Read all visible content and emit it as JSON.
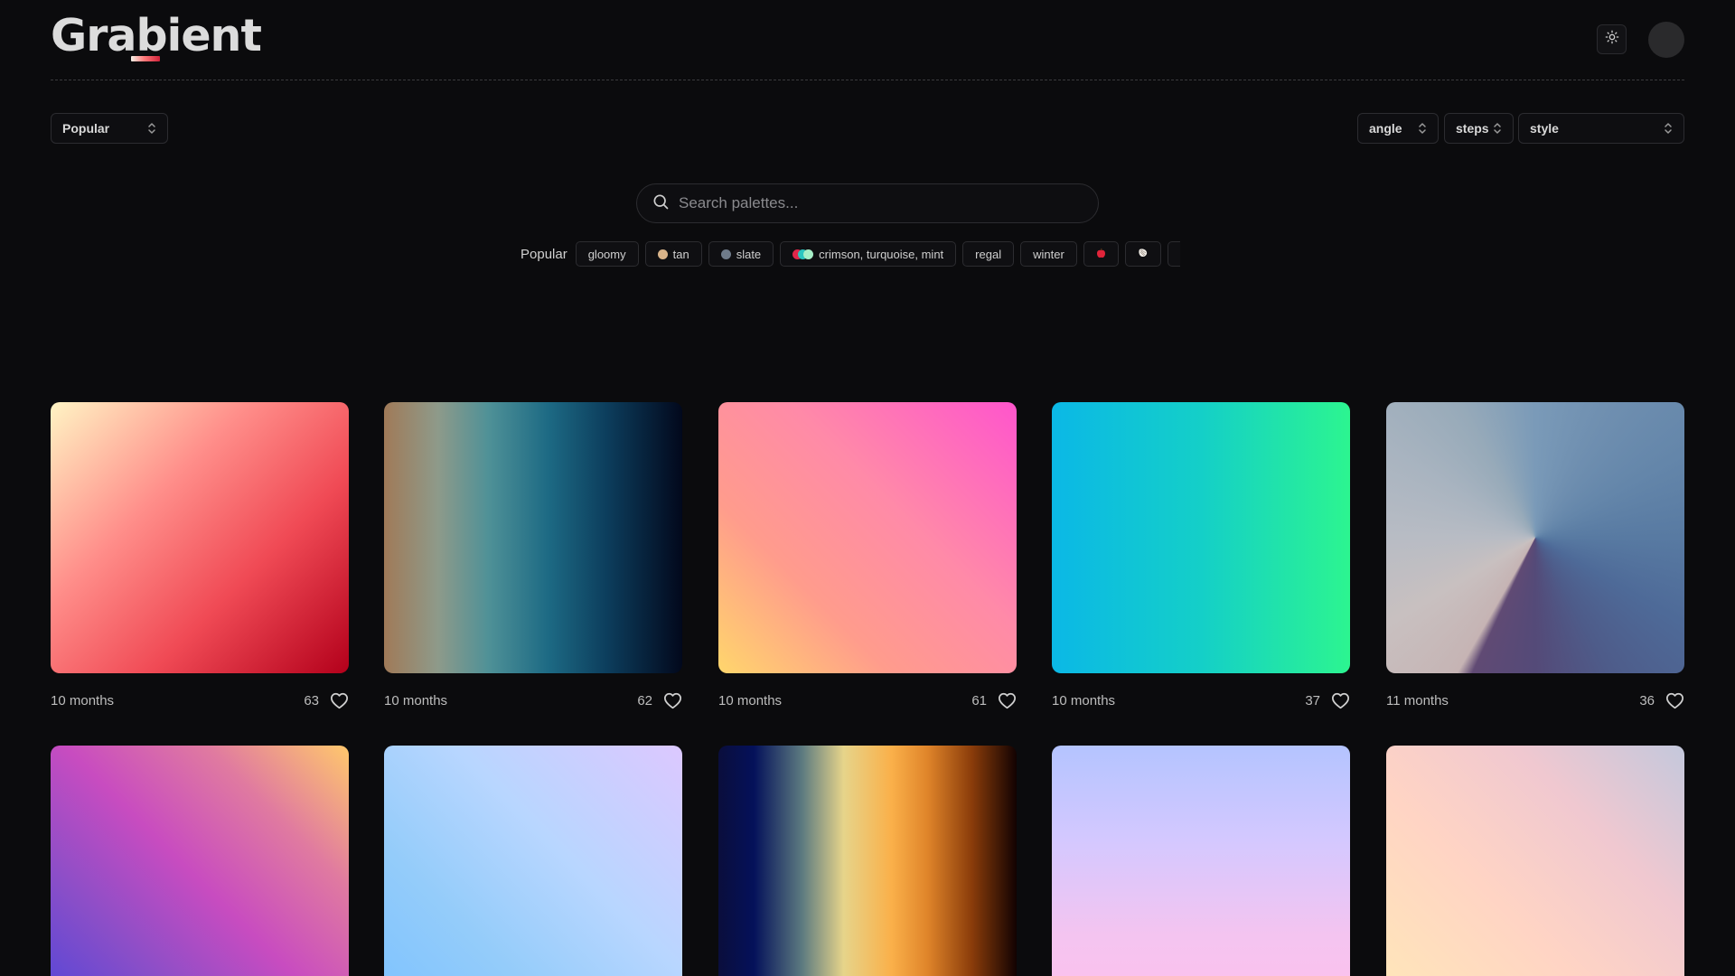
{
  "brand": {
    "name": "Grabient"
  },
  "header": {
    "theme_icon": "sun-icon",
    "avatar": "avatar"
  },
  "filters": {
    "sort": "Popular",
    "angle": "angle",
    "steps": "steps",
    "style": "style"
  },
  "search": {
    "placeholder": "Search palettes..."
  },
  "tags": {
    "label": "Popular",
    "items": [
      {
        "label": "gloomy"
      },
      {
        "label": "tan",
        "color": "#d9b48a"
      },
      {
        "label": "slate",
        "color": "#6f7b8a"
      },
      {
        "label": "crimson, turquoise, mint",
        "colors": [
          "#e0264a",
          "#2cc6c0",
          "#a7f0c8"
        ]
      },
      {
        "label": "regal"
      },
      {
        "label": "winter"
      },
      {
        "label": "🍎"
      },
      {
        "label": "🐚"
      }
    ]
  },
  "palettes": [
    {
      "age": "10 months",
      "likes": "63",
      "gradient": "linear-gradient(135deg,#fff4c4 0%,#ff8e8a 35%,#f04a55 65%,#b3001b 100%)"
    },
    {
      "age": "10 months",
      "likes": "62",
      "gradient": "linear-gradient(90deg,#a07a58 0%,#8e9a8a 18%,#4f9197 35%,#1d6a84 55%,#0c3d5c 75%,#02081c 100%)"
    },
    {
      "age": "10 months",
      "likes": "61",
      "gradient": "linear-gradient(225deg,#ff55cc 0%,#ff8aa8 40%,#ff9c8c 70%,#ffd66c 100%)"
    },
    {
      "age": "10 months",
      "likes": "37",
      "gradient": "linear-gradient(90deg,#0bb8e6 0%,#14cfc8 50%,#2cf590 100%)"
    },
    {
      "age": "11 months",
      "likes": "36",
      "gradient": "conic-gradient(from 0deg at 50% 50%,#7a9ab8 0deg,#6f8fb0 30deg,#6486aa 60deg,#587aa2 90deg,#4e6a98 120deg,#4e5c8a 150deg,#544a78 180deg,#604a74 205deg,#c6b4b4 210deg,#c8c0c0 240deg,#b8bcc4 270deg,#a9b4c0 300deg,#97aab9 330deg,#7a9ab8 360deg)"
    },
    {
      "age": "",
      "likes": "",
      "gradient": "linear-gradient(225deg,#ffc86c 0%,#e07aa0 25%,#c84cc0 50%,#8a4ec8 75%,#5046d8 100%)"
    },
    {
      "age": "",
      "likes": "",
      "gradient": "linear-gradient(225deg,#dcc8ff 0%,#b8d6ff 40%,#94ccfa 70%,#7cc2ff 100%)"
    },
    {
      "age": "",
      "likes": "",
      "gradient": "linear-gradient(90deg,#0a0e3c 0%,#04115a 12%,#5c7a80 28%,#e6d48a 42%,#fab04a 58%,#e0852a 70%,#8a3c0a 85%,#120202 100%)"
    },
    {
      "age": "",
      "likes": "",
      "gradient": "linear-gradient(180deg,#b4c4ff 0%,#d4c8ff 35%,#f4c4f0 70%,#ffc0ec 100%)"
    },
    {
      "age": "",
      "likes": "",
      "gradient": "linear-gradient(45deg,#ffe8b8 0%,#ffd4c4 40%,#f0c8d0 70%,#c4c8dc 100%)"
    }
  ]
}
